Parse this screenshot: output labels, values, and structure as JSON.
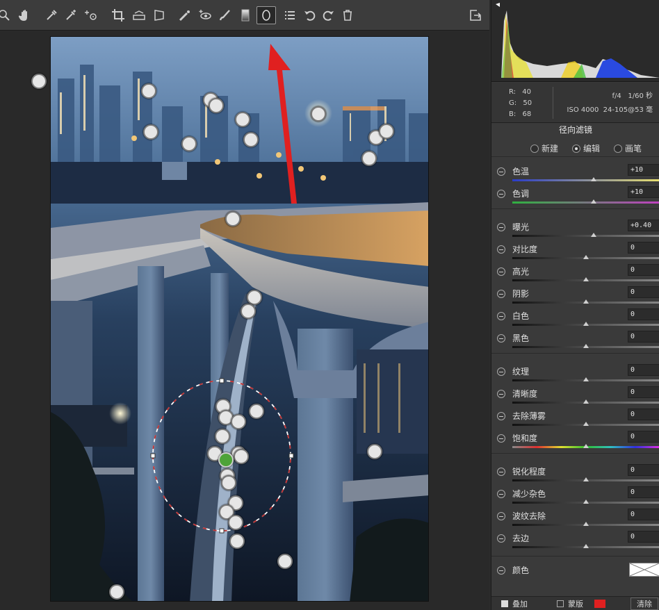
{
  "toolbar": {
    "tools": [
      {
        "name": "zoom-icon",
        "glyph": "⚲"
      },
      {
        "name": "hand-icon",
        "glyph": "✋"
      },
      {
        "name": "white-balance-icon",
        "glyph": "✒"
      },
      {
        "name": "color-sampler-icon",
        "glyph": "✎"
      },
      {
        "name": "target-adjust-icon",
        "glyph": "⊹"
      },
      {
        "name": "crop-icon",
        "glyph": "⌗"
      },
      {
        "name": "straighten-icon",
        "glyph": "⊟"
      },
      {
        "name": "transform-icon",
        "glyph": "▱"
      },
      {
        "name": "spot-removal-icon",
        "glyph": "⟋"
      },
      {
        "name": "red-eye-icon",
        "glyph": "◉"
      },
      {
        "name": "brush-icon",
        "glyph": "⌿"
      },
      {
        "name": "graduated-filter-icon",
        "glyph": "▮"
      },
      {
        "name": "radial-filter-icon",
        "glyph": "0"
      },
      {
        "name": "list-icon",
        "glyph": "☰"
      },
      {
        "name": "rotate-left-icon",
        "glyph": "↺"
      },
      {
        "name": "rotate-right-icon",
        "glyph": "↻"
      },
      {
        "name": "trash-icon",
        "glyph": "🗑"
      }
    ],
    "export_icon": "export-icon"
  },
  "readout": {
    "r_label": "R:",
    "r": "40",
    "g_label": "G:",
    "g": "50",
    "b_label": "B:",
    "b": "68",
    "aperture": "f/4",
    "shutter": "1/60 秒",
    "iso": "ISO 4000",
    "lens": "24-105@53 毫"
  },
  "panel": {
    "title": "径向滤镜",
    "modes": [
      "新建",
      "编辑",
      "画笔"
    ],
    "mode_selected": "编辑",
    "sliders": [
      {
        "label": "色温",
        "value": "+10",
        "pos": 0.55,
        "track": "temp"
      },
      {
        "label": "色调",
        "value": "+10",
        "pos": 0.55,
        "track": "tint"
      },
      {
        "label": "曝光",
        "value": "+0.40",
        "pos": 0.55,
        "track": "gray"
      },
      {
        "label": "对比度",
        "value": "0",
        "pos": 0.5,
        "track": "gray"
      },
      {
        "label": "高光",
        "value": "0",
        "pos": 0.5,
        "track": "gray"
      },
      {
        "label": "阴影",
        "value": "0",
        "pos": 0.5,
        "track": "gray"
      },
      {
        "label": "白色",
        "value": "0",
        "pos": 0.5,
        "track": "gray"
      },
      {
        "label": "黑色",
        "value": "0",
        "pos": 0.5,
        "track": "gray"
      },
      {
        "label": "纹理",
        "value": "0",
        "pos": 0.5,
        "track": "gray"
      },
      {
        "label": "清晰度",
        "value": "0",
        "pos": 0.5,
        "track": "gray"
      },
      {
        "label": "去除薄雾",
        "value": "0",
        "pos": 0.5,
        "track": "gray"
      },
      {
        "label": "饱和度",
        "value": "0",
        "pos": 0.5,
        "track": "sat"
      },
      {
        "label": "锐化程度",
        "value": "0",
        "pos": 0.5,
        "track": "gray"
      },
      {
        "label": "减少杂色",
        "value": "0",
        "pos": 0.5,
        "track": "gray"
      },
      {
        "label": "波纹去除",
        "value": "0",
        "pos": 0.5,
        "track": "gray"
      },
      {
        "label": "去边",
        "value": "0",
        "pos": 0.5,
        "track": "gray"
      }
    ],
    "color_label": "颜色",
    "bottom": {
      "overlay": "叠加",
      "mask": "蒙版",
      "clear": "清除"
    }
  },
  "colors": {
    "accent_red": "#e02020",
    "active_pin": "#4ea338"
  }
}
